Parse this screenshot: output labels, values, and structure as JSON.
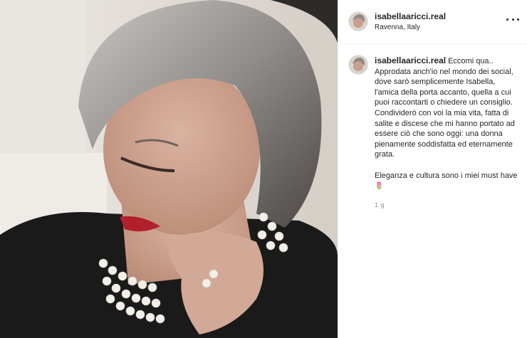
{
  "post": {
    "username": "isabellaaricci.real",
    "location": "Ravenna, Italy",
    "caption": "Eccomi qua..\nApprodata anch'io nel mondo dei social, dove sarò semplicemente Isabella, l'amica della porta accanto, quella a cui puoi raccontarti o chiedere un consiglio.\nCondividerò con voi la mia vita, fatta di salite e discese che mi hanno portato ad essere ciò che sono oggi: una donna pienamente soddisfatta ed eternamente grata.\n\nEleganza e cultura sono i miei must have",
    "emoji": "tulip-emoji",
    "emoji_glyph": "🌷",
    "time": "1 g"
  },
  "icons": {
    "more": "more-options-icon"
  },
  "colors": {
    "text": "#262626",
    "muted": "#8e8e8e",
    "divider": "#efefef"
  }
}
